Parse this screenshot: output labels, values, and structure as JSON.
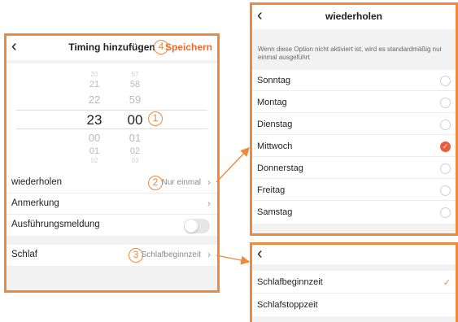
{
  "timing": {
    "title": "Timing hinzufügen",
    "save_label": "Speichern",
    "hours": [
      "20",
      "21",
      "22",
      "23",
      "00",
      "01",
      "02"
    ],
    "minutes": [
      "57",
      "58",
      "59",
      "00",
      "01",
      "02",
      "03"
    ],
    "rows": {
      "repeat": {
        "label": "wiederholen",
        "value": "Nur einmal"
      },
      "note": {
        "label": "Anmerkung",
        "value": ""
      },
      "notify": {
        "label": "Ausführungsmeldung",
        "enabled": false
      },
      "action": {
        "label": "Schlaf",
        "value": "Schlafbeginnzeit"
      }
    },
    "markers": {
      "picker": "1",
      "repeat": "2",
      "action": "3",
      "save": "4"
    }
  },
  "repeat_screen": {
    "title": "wiederholen",
    "description": "Wenn diese Option nicht aktiviert ist, wird es standardmäßig nur einmal ausgeführt",
    "days": [
      {
        "label": "Sonntag",
        "checked": false
      },
      {
        "label": "Montag",
        "checked": false
      },
      {
        "label": "Dienstag",
        "checked": false
      },
      {
        "label": "Mittwoch",
        "checked": true
      },
      {
        "label": "Donnerstag",
        "checked": false
      },
      {
        "label": "Freitag",
        "checked": false
      },
      {
        "label": "Samstag",
        "checked": false
      }
    ]
  },
  "sleep_screen": {
    "options": [
      {
        "label": "Schlafbeginnzeit",
        "selected": true
      },
      {
        "label": "Schlafstoppzeit",
        "selected": false
      }
    ]
  },
  "colors": {
    "accent": "#ee8a3c",
    "save": "#e96b2a",
    "checked": "#ee5a3d"
  },
  "icons": {
    "back": "chevron-left-icon",
    "chevron": "chevron-right-icon",
    "check": "check-icon"
  }
}
